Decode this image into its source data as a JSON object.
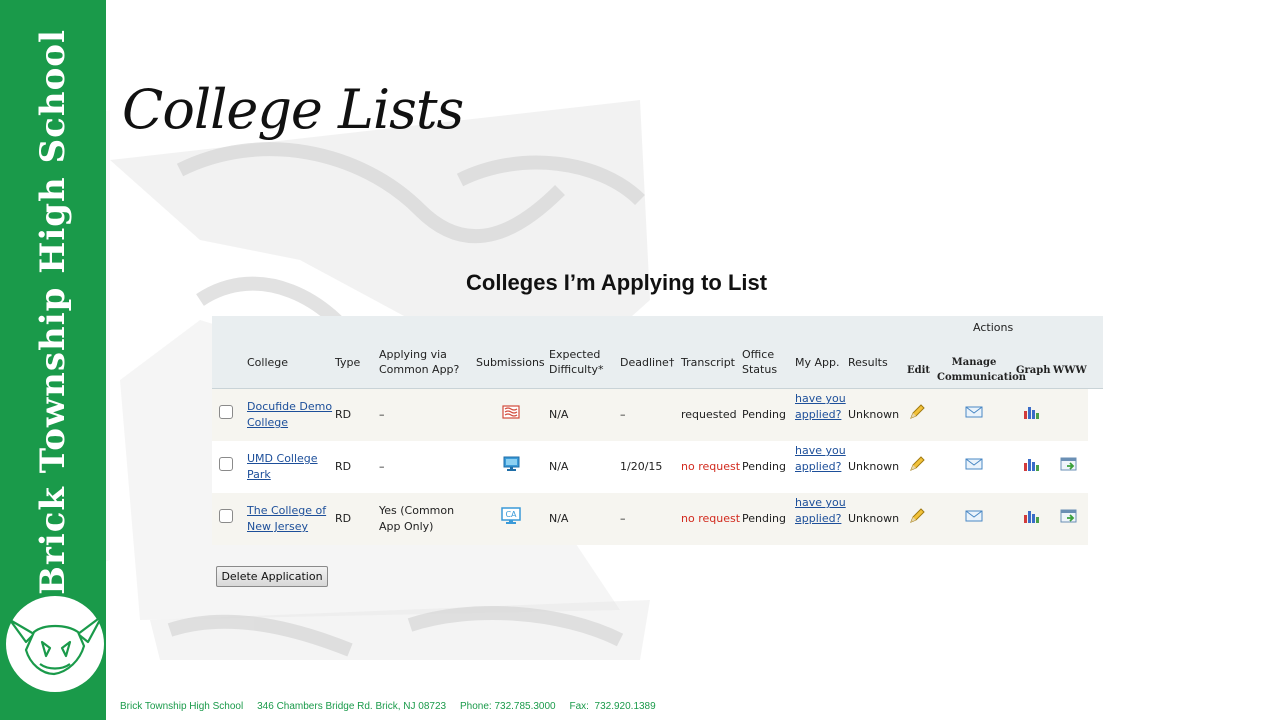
{
  "sidebar": {
    "school_name": "Brick Township High School"
  },
  "page": {
    "title": "College Lists",
    "list_heading": "Colleges I’m Applying to List"
  },
  "table": {
    "actions_header": "Actions",
    "headers": {
      "college": "College",
      "type": "Type",
      "applying_via_1": "Applying via",
      "applying_via_2": "Common App?",
      "submissions": "Submissions",
      "expected_1": "Expected",
      "expected_2": "Difficulty*",
      "deadline": "Deadline†",
      "transcript": "Transcript",
      "office_1": "Office",
      "office_2": "Status",
      "my_app": "My App.",
      "results": "Results",
      "edit": "Edit",
      "manage_1": "Manage",
      "manage_2": "Communication",
      "graph": "Graph",
      "www": "WWW"
    },
    "rows": [
      {
        "college_1": "Docufide Demo",
        "college_2": "College",
        "type": "RD",
        "applying_1": "–",
        "applying_2": "",
        "submission_icon": "paper-submission-icon",
        "difficulty": "N/A",
        "deadline": "–",
        "transcript": "requested",
        "office_status": "Pending",
        "my_app_1": "have you",
        "my_app_2": "applied?",
        "results": "Unknown"
      },
      {
        "college_1": "UMD College",
        "college_2": "Park",
        "type": "RD",
        "applying_1": "–",
        "applying_2": "",
        "submission_icon": "electronic-submission-icon",
        "difficulty": "N/A",
        "deadline": "1/20/15",
        "transcript": "no request",
        "office_status": "Pending",
        "my_app_1": "have you",
        "my_app_2": "applied?",
        "results": "Unknown"
      },
      {
        "college_1": "The College of",
        "college_2": "New Jersey",
        "type": "RD",
        "applying_1": "Yes (Common",
        "applying_2": "App Only)",
        "submission_icon": "common-app-submission-icon",
        "submission_ca": "CA",
        "difficulty": "N/A",
        "deadline": "–",
        "transcript": "no request",
        "office_status": "Pending",
        "my_app_1": "have you",
        "my_app_2": "applied?",
        "results": "Unknown"
      }
    ],
    "delete_button": "Delete Application"
  },
  "footer": {
    "text": "Brick Township High School     346 Chambers Bridge Rd. Brick, NJ 08723     Phone: 732.785.3000     Fax:  732.920.1389"
  },
  "colors": {
    "sidebar_green": "#1a9a4a",
    "link_blue": "#1d4f9a",
    "alert_red": "#d22a1e"
  }
}
